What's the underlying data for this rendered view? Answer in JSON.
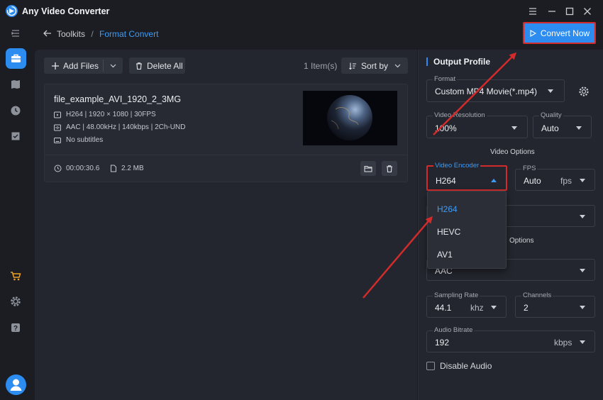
{
  "app": {
    "title": "Any Video Converter"
  },
  "breadcrumb": {
    "items": [
      "Toolkits",
      "Format Convert"
    ],
    "separator": "/"
  },
  "toolbar": {
    "convert_now_label": "Convert Now",
    "add_files_label": "Add Files",
    "delete_all_label": "Delete All",
    "items_count": "1 Item(s)",
    "sort_by_label": "Sort by"
  },
  "file": {
    "name": "file_example_AVI_1920_2_3MG",
    "video_info": "H264 | 1920 × 1080 | 30FPS",
    "audio_info": "AAC | 48.00kHz | 140kbps | 2Ch-UND",
    "subtitles": "No subtitles",
    "duration": "00:00:30.6",
    "size": "2.2 MB"
  },
  "profile": {
    "title": "Output Profile",
    "format": {
      "label": "Format",
      "value": "Custom MP4 Movie(*.mp4)"
    },
    "video_resolution": {
      "label": "Video Resolution",
      "value": "100%"
    },
    "quality": {
      "label": "Quality",
      "value": "Auto"
    },
    "video_options_title": "Video Options",
    "video_encoder": {
      "label": "Video Encoder",
      "value": "H264",
      "options": [
        "H264",
        "HEVC",
        "AV1"
      ]
    },
    "fps": {
      "label": "FPS",
      "value": "Auto",
      "unit": "fps"
    },
    "audio_options_title": "Options",
    "audio_encoder": {
      "value": "AAC"
    },
    "sampling_rate": {
      "label": "Sampling Rate",
      "value": "44.1",
      "unit": "khz"
    },
    "channels": {
      "label": "Channels",
      "value": "2"
    },
    "audio_bitrate": {
      "label": "Audio Bitrate",
      "value": "192",
      "unit": "kbps"
    },
    "disable_audio_label": "Disable Audio"
  },
  "colors": {
    "accent": "#2d8cf0",
    "background": "#1b1d23",
    "panel": "#23262e",
    "annotation": "#d22b2b"
  },
  "icons": {
    "sidebar": [
      "menu-icon",
      "toolbox-icon",
      "library-icon",
      "history-icon",
      "tasks-icon",
      "cart-icon",
      "settings-icon",
      "help-icon",
      "user-icon"
    ]
  }
}
